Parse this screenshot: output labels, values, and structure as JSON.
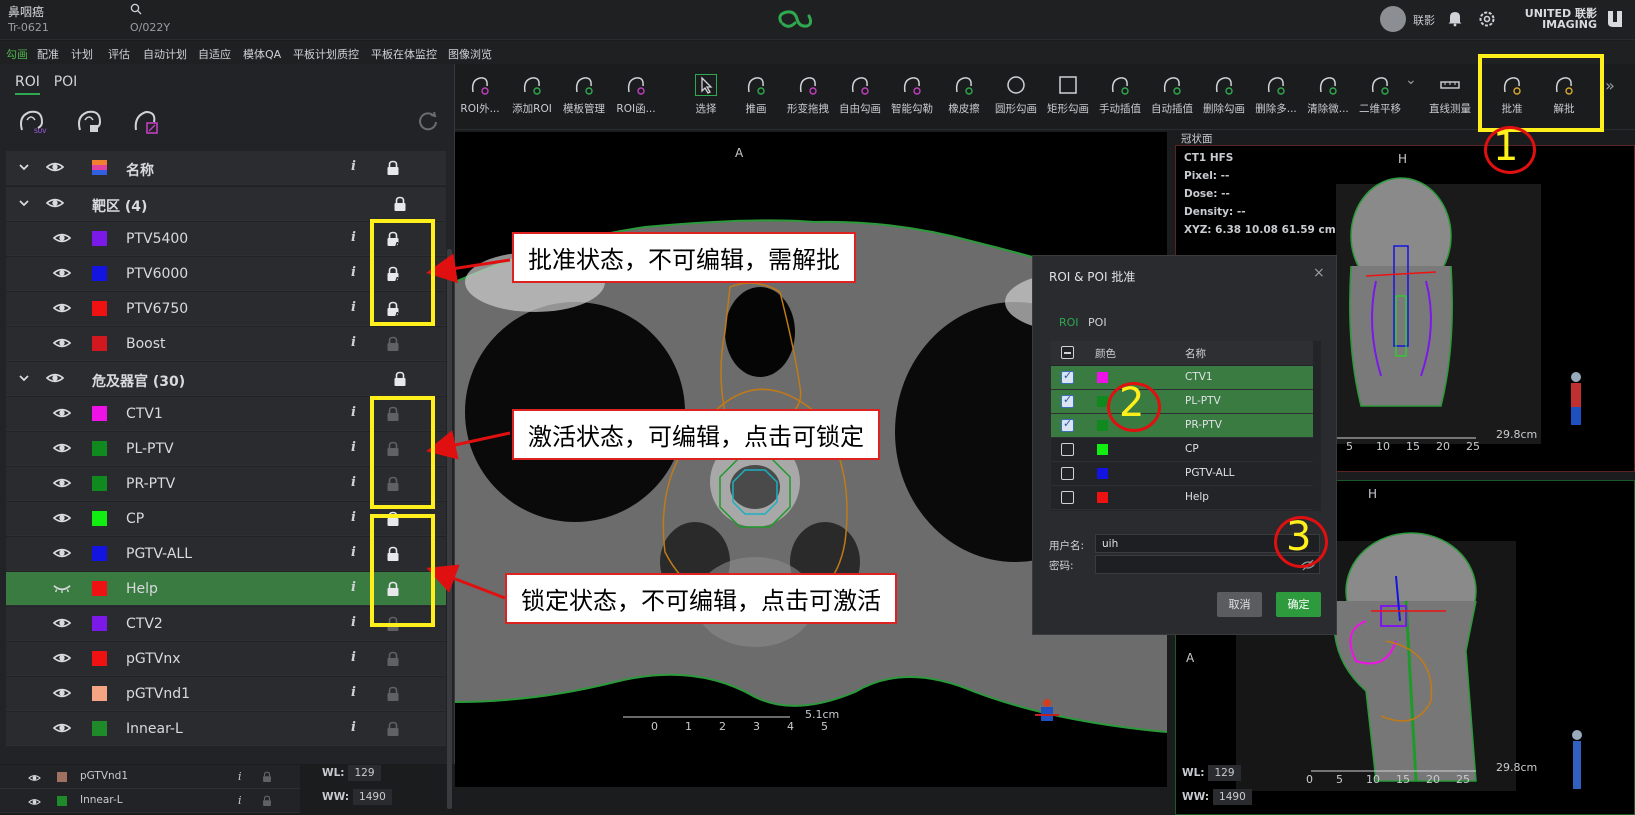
{
  "patient": {
    "name": "鼻咽癌",
    "id": "Tr-0621",
    "course": "O/022Y"
  },
  "user": {
    "name": "联影"
  },
  "brand": {
    "line1": "UNITED 联影",
    "line2": "IMAGING"
  },
  "menu": [
    "勾画",
    "配准",
    "计划",
    "评估",
    "自动计划",
    "自适应",
    "模体QA",
    "平板计划质控",
    "平板在体监控",
    "图像浏览"
  ],
  "toolbar": {
    "tools": [
      "ROI外...",
      "添加ROI",
      "模板管理",
      "ROI函...",
      "选择",
      "推画",
      "形变拖拽",
      "自由勾画",
      "智能勾勒",
      "橡皮擦",
      "圆形勾画",
      "矩形勾画",
      "手动插值",
      "自动插值",
      "删除勾画",
      "删除多...",
      "清除微...",
      "二维平移",
      "直线测量",
      "批准",
      "解批"
    ]
  },
  "roi_panel": {
    "tabs": [
      "ROI",
      "POI"
    ],
    "header_label": "名称",
    "groups": [
      {
        "label": "靶区 (4)"
      },
      {
        "label": "危及器官 (30)"
      }
    ],
    "rows": [
      {
        "name": "PTV5400",
        "color": "#7b19e8",
        "state": "approved"
      },
      {
        "name": "PTV6000",
        "color": "#1414e0",
        "state": "approved"
      },
      {
        "name": "PTV6750",
        "color": "#ee1212",
        "state": "approved"
      },
      {
        "name": "Boost",
        "color": "#d0181e",
        "state": "active"
      },
      {
        "name": "CTV1",
        "color": "#ee12e6",
        "state": "active"
      },
      {
        "name": "PL-PTV",
        "color": "#108a1e",
        "state": "active"
      },
      {
        "name": "PR-PTV",
        "color": "#108a1e",
        "state": "active"
      },
      {
        "name": "CP",
        "color": "#12ee12",
        "state": "locked"
      },
      {
        "name": "PGTV-ALL",
        "color": "#1414e0",
        "state": "locked"
      },
      {
        "name": "Help",
        "color": "#ee1212",
        "state": "locked"
      },
      {
        "name": "CTV2",
        "color": "#7b19e8",
        "state": "active"
      },
      {
        "name": "pGTVnx",
        "color": "#ee1212",
        "state": "active"
      },
      {
        "name": "pGTVnd1",
        "color": "#f5a484",
        "state": "active"
      },
      {
        "name": "Innear-L",
        "color": "#1e8a2a",
        "state": "active"
      }
    ]
  },
  "mini_rows": [
    {
      "name": "pGTVnd1",
      "color": "#a07060"
    },
    {
      "name": "Innear-L",
      "color": "#1e8a2a"
    }
  ],
  "axial": {
    "top_label": "A",
    "scale_ticks": [
      "0",
      "1",
      "2",
      "3",
      "4",
      "5"
    ],
    "scale_text": "5.1cm",
    "wl_label": "WL:",
    "wl": "129",
    "ww_label": "WW:",
    "ww": "1490"
  },
  "coronal": {
    "title": "冠状面",
    "orientation": "H",
    "meta": {
      "name": "CT1 HFS",
      "pixel": "Pixel:  --",
      "dose": "Dose:  --",
      "density": "Density:  --",
      "xyz": "XYZ: 6.38 10.08 61.59 cm"
    },
    "scale_ticks": [
      "5",
      "10",
      "15",
      "20",
      "25"
    ],
    "scale_text": "29.8cm"
  },
  "sagittal": {
    "orientation": "H",
    "side_label": "A",
    "scale_ticks": [
      "0",
      "5",
      "10",
      "15",
      "20",
      "25"
    ],
    "scale_text": "29.8cm",
    "wl_label": "WL:",
    "wl": "129",
    "ww_label": "WW:",
    "ww": "1490"
  },
  "callouts": {
    "approved": "批准状态，不可编辑，需解批",
    "active": "激活状态，可编辑，点击可锁定",
    "locked": "锁定状态，不可编辑，点击可激活"
  },
  "steps": [
    "1",
    "2",
    "3"
  ],
  "dialog": {
    "title": "ROI & POI 批准",
    "close": "×",
    "tabs": [
      "ROI",
      "POI"
    ],
    "col_color": "颜色",
    "col_name": "名称",
    "rows": [
      {
        "name": "CTV1",
        "color": "#ee12e6",
        "checked": true
      },
      {
        "name": "PL-PTV",
        "color": "#108a1e",
        "checked": true
      },
      {
        "name": "PR-PTV",
        "color": "#108a1e",
        "checked": true
      },
      {
        "name": "CP",
        "color": "#12ee12",
        "checked": false
      },
      {
        "name": "PGTV-ALL",
        "color": "#1414e0",
        "checked": false
      },
      {
        "name": "Help",
        "color": "#ee1212",
        "checked": false
      }
    ],
    "user_label": "用户名:",
    "user_value": "uih",
    "pass_label": "密码:",
    "cancel": "取消",
    "ok": "确定"
  }
}
